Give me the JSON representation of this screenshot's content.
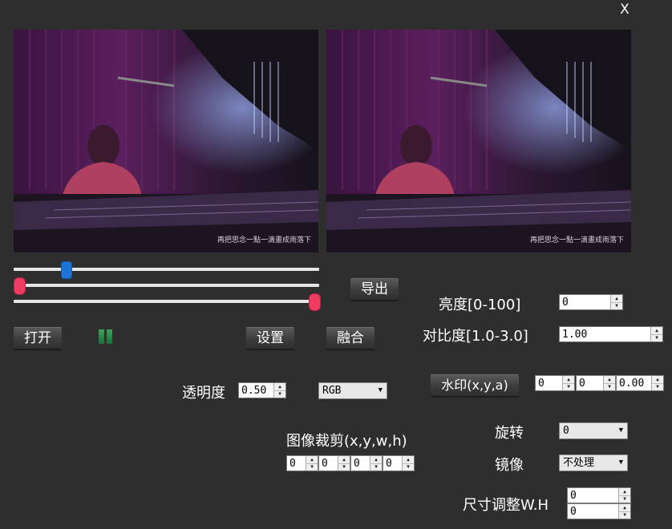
{
  "window": {
    "close_label": "X"
  },
  "preview": {
    "subtitle": "再把思念一點一滴畫成雨落下"
  },
  "sliders": {
    "position_percent": 16,
    "range_start_percent": 0,
    "range_end_percent": 100
  },
  "buttons": {
    "open": "打开",
    "settings": "设置",
    "merge": "融合",
    "export": "导出",
    "watermark": "水印(x,y,a)"
  },
  "transparency": {
    "label": "透明度",
    "value": "0.50"
  },
  "color_mode": {
    "value": "RGB"
  },
  "brightness": {
    "label": "亮度[0-100]",
    "value": "0"
  },
  "contrast": {
    "label": "对比度[1.0-3.0]",
    "value": "1.00"
  },
  "watermark": {
    "x": "0",
    "y": "0",
    "a": "0.00"
  },
  "crop": {
    "label": "图像裁剪(x,y,w,h)",
    "x": "0",
    "y": "0",
    "w": "0",
    "h": "0"
  },
  "rotate": {
    "label": "旋转",
    "value": "0"
  },
  "mirror": {
    "label": "镜像",
    "value": "不处理"
  },
  "resize": {
    "label": "尺寸调整W.H",
    "w": "0",
    "h": "0"
  },
  "colors": {
    "background": "#2e2e2e",
    "slider_thumb_blue": "#1e74d6",
    "slider_thumb_red": "#ee3c63",
    "pause_green": "#2e8b4a"
  }
}
